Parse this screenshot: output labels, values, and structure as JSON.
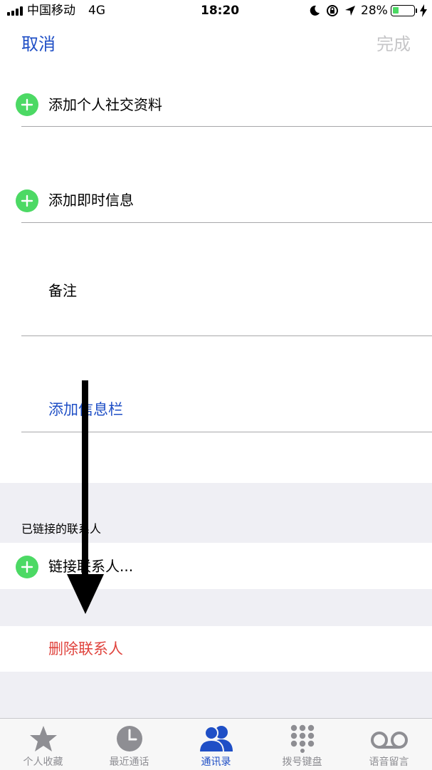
{
  "status_bar": {
    "carrier": "中国移动",
    "network": "4G",
    "time": "18:20",
    "battery": "28%",
    "battery_level": 0.28
  },
  "nav": {
    "cancel_label": "取消",
    "done_label": "完成"
  },
  "rows": {
    "add_social_profile": "添加个人社交资料",
    "add_instant_message": "添加即时信息",
    "notes": "备注",
    "add_field": "添加信息栏"
  },
  "linked": {
    "section_header": "已链接的联系人",
    "link_contact": "链接联系人..."
  },
  "delete_contact": "删除联系人",
  "tabbar": {
    "tabs": [
      {
        "label": "个人收藏",
        "icon": "star-icon"
      },
      {
        "label": "最近通话",
        "icon": "clock-icon"
      },
      {
        "label": "通讯录",
        "icon": "contacts-icon"
      },
      {
        "label": "拨号键盘",
        "icon": "keypad-icon"
      },
      {
        "label": "语音留言",
        "icon": "voicemail-icon"
      }
    ],
    "active_index": 2
  },
  "colors": {
    "accent": "#1f4fc6",
    "add_green": "#4cd964",
    "destructive": "#e0443e",
    "disabled": "#c6c6c8",
    "group_bg": "#efeff4"
  }
}
